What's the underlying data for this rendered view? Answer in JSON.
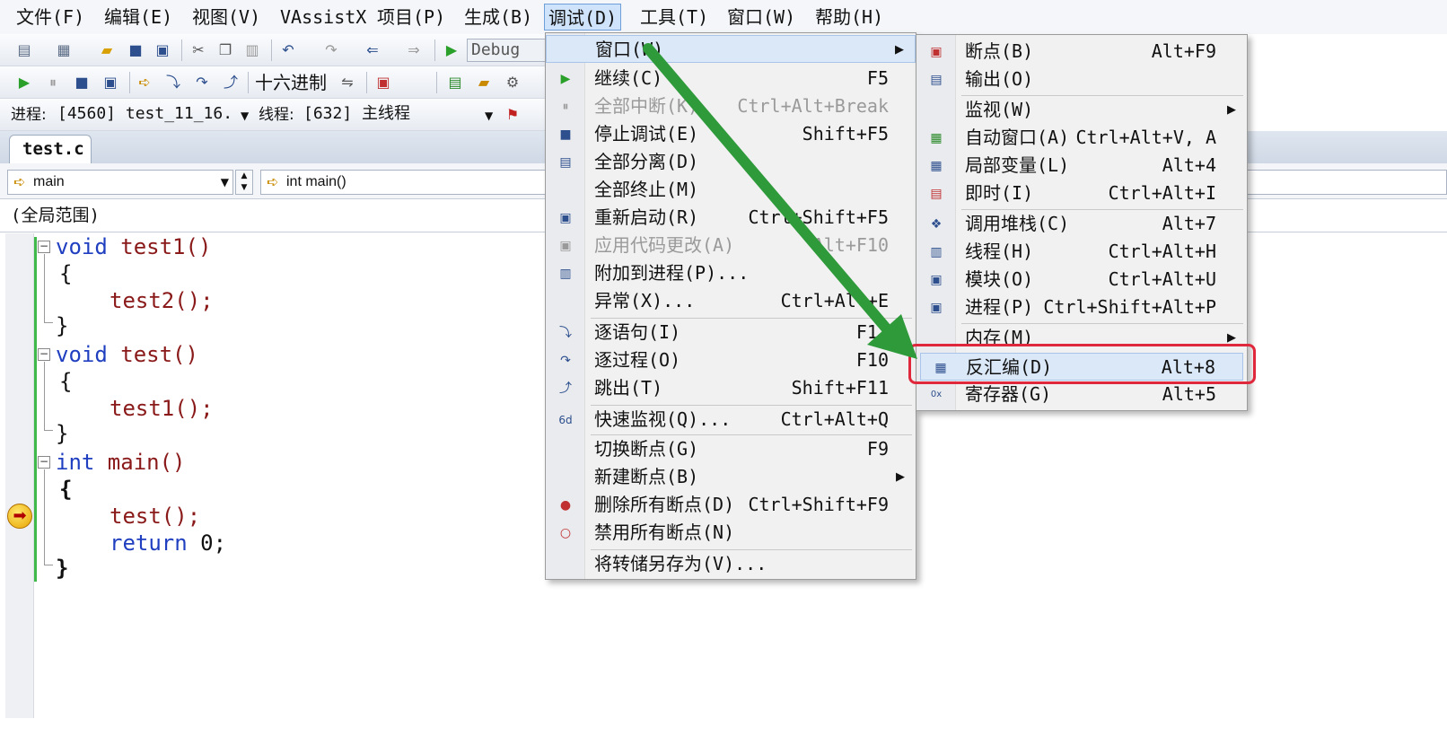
{
  "menubar": {
    "items": [
      "文件(F)",
      "编辑(E)",
      "视图(V)",
      "VAssistX",
      "项目(P)",
      "生成(B)",
      "调试(D)",
      "工具(T)",
      "窗口(W)",
      "帮助(H)"
    ],
    "active_index": 6
  },
  "toolbar": {
    "config_value": "Debug",
    "hex_label": "十六进制",
    "process_label": "进程:",
    "process_value": "[4560] test_11_16.",
    "thread_label": "线程:",
    "thread_value": "[632] 主线程"
  },
  "editor": {
    "tab_label": "test.c",
    "nav_left": "main",
    "nav_right": "int main()",
    "scope": "(全局范围)",
    "lines": {
      "l1_kw": "void",
      "l1_fn": " test1()",
      "l2": "{",
      "l3": "test2();",
      "l4": "}",
      "l5_kw": "void",
      "l5_fn": " test()",
      "l6": "{",
      "l7": "test1();",
      "l8": "}",
      "l9_kw": "int",
      "l9_fn": " main()",
      "l10": "{",
      "l11": "test();",
      "l12_kw": "return",
      "l12_rest": " 0;",
      "l13": "}"
    }
  },
  "debug_menu": {
    "items": [
      {
        "label": "窗口(W)",
        "shortcut": "",
        "submenu": true
      },
      {
        "label": "继续(C)",
        "shortcut": "F5"
      },
      {
        "label": "全部中断(K)",
        "shortcut": "Ctrl+Alt+Break",
        "disabled": true
      },
      {
        "label": "停止调试(E)",
        "shortcut": "Shift+F5"
      },
      {
        "label": "全部分离(D)",
        "shortcut": ""
      },
      {
        "label": "全部终止(M)",
        "shortcut": ""
      },
      {
        "label": "重新启动(R)",
        "shortcut": "Ctrl+Shift+F5"
      },
      {
        "label": "应用代码更改(A)",
        "shortcut": "Alt+F10",
        "disabled": true
      },
      {
        "label": "附加到进程(P)...",
        "shortcut": ""
      },
      {
        "label": "异常(X)...",
        "shortcut": "Ctrl+Alt+E"
      },
      {
        "label": "逐语句(I)",
        "shortcut": "F11"
      },
      {
        "label": "逐过程(O)",
        "shortcut": "F10"
      },
      {
        "label": "跳出(T)",
        "shortcut": "Shift+F11"
      },
      {
        "label": "快速监视(Q)...",
        "shortcut": "Ctrl+Alt+Q"
      },
      {
        "label": "切换断点(G)",
        "shortcut": "F9"
      },
      {
        "label": "新建断点(B)",
        "shortcut": "",
        "submenu": true
      },
      {
        "label": "删除所有断点(D)",
        "shortcut": "Ctrl+Shift+F9"
      },
      {
        "label": "禁用所有断点(N)",
        "shortcut": ""
      },
      {
        "label": "将转储另存为(V)...",
        "shortcut": ""
      }
    ]
  },
  "window_submenu": {
    "items": [
      {
        "label": "断点(B)",
        "shortcut": "Alt+F9"
      },
      {
        "label": "输出(O)",
        "shortcut": ""
      },
      {
        "label": "监视(W)",
        "shortcut": "",
        "submenu": true
      },
      {
        "label": "自动窗口(A)",
        "shortcut": "Ctrl+Alt+V, A"
      },
      {
        "label": "局部变量(L)",
        "shortcut": "Alt+4"
      },
      {
        "label": "即时(I)",
        "shortcut": "Ctrl+Alt+I"
      },
      {
        "label": "调用堆栈(C)",
        "shortcut": "Alt+7"
      },
      {
        "label": "线程(H)",
        "shortcut": "Ctrl+Alt+H"
      },
      {
        "label": "模块(O)",
        "shortcut": "Ctrl+Alt+U"
      },
      {
        "label": "进程(P)",
        "shortcut": "Ctrl+Shift+Alt+P"
      },
      {
        "label": "内存(M)",
        "shortcut": "",
        "submenu": true
      },
      {
        "label": "反汇编(D)",
        "shortcut": "Alt+8",
        "highlighted": true
      },
      {
        "label": "寄存器(G)",
        "shortcut": "Alt+5"
      }
    ]
  },
  "colors": {
    "annotation_arrow": "#2e9a3a",
    "highlight_box": "#e0283c",
    "keyword": "#1f3fc0",
    "identifier": "#8a1a1a"
  }
}
